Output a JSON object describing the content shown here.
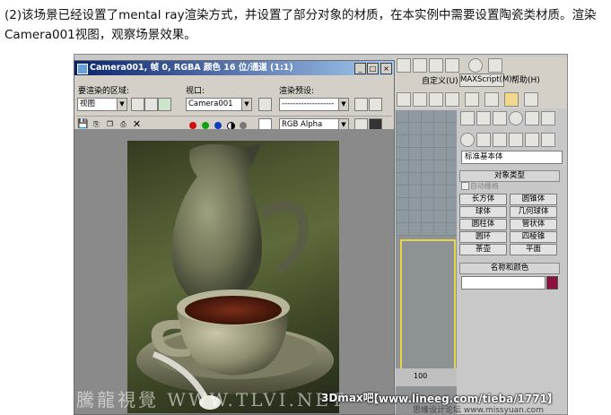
{
  "caption": "(2)该场景已经设置了mental ray渲染方式，并设置了部分对象的材质，在本实例中需要设置陶瓷类材质。渲染Camera001视图，观察场景效果。",
  "max_window": {
    "menu": {
      "edit": "自定义(U)",
      "maxscript": "MAXScript(M)",
      "help": "帮助(H)"
    },
    "command_panel": {
      "category": "标准基本体",
      "object_type_header": "对象类型",
      "autogrid": "自动栅格",
      "buttons": [
        "长方体",
        "圆锥体",
        "球体",
        "几何球体",
        "圆柱体",
        "管状体",
        "圆环",
        "四棱锥",
        "茶壶",
        "平面"
      ],
      "name_color_header": "名称和颜色",
      "object_color": "#8c1040"
    },
    "ruler_value": "100"
  },
  "render_window": {
    "title": "Camera001, 帧 0, RGBA 颜色 16 位/通道 (1:1)",
    "area_label": "要渲染的区域:",
    "area_value": "视图",
    "viewport_label": "视口:",
    "viewport_value": "Camera001",
    "preset_label": "渲染预设:",
    "preset_value": "-------------------",
    "channel_value": "RGB Alpha",
    "minimize": "_",
    "maximize": "□",
    "close": "×"
  },
  "watermarks": {
    "left": "騰龍視覺 WWW.TLVI.NET",
    "brand": "3Dmax吧",
    "url": "【www.lineeg.com/tieba/1771】",
    "bottom": "思缘设计论坛 www.missyuan.com"
  }
}
